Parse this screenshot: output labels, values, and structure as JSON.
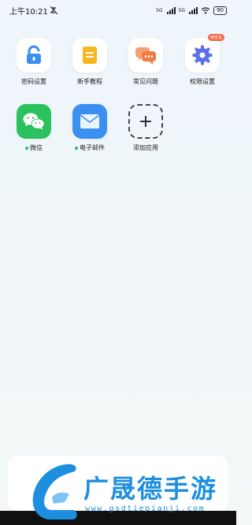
{
  "status_bar": {
    "time": "上午10:21",
    "signal1_label": "5G",
    "signal2_label": "5G",
    "battery": "90"
  },
  "apps": {
    "row1": [
      {
        "label": "密码设置",
        "icon": "unlock-icon",
        "color": "#3a90f0"
      },
      {
        "label": "新手教程",
        "icon": "document-icon",
        "color": "#f5b81c"
      },
      {
        "label": "常见问题",
        "icon": "chat-bubbles-icon",
        "color": "#f07c45"
      },
      {
        "label": "权限设置",
        "icon": "gear-icon",
        "color": "#5b6fe6",
        "badge": "待优化"
      }
    ],
    "row2": [
      {
        "label": "微信",
        "icon": "wechat-icon",
        "color": "#2bc15c"
      },
      {
        "label": "电子邮件",
        "icon": "mail-icon",
        "color": "#3b8ff0"
      },
      {
        "label": "添加应用",
        "icon": "plus-icon"
      }
    ]
  },
  "watermark": {
    "title": "广晟德手游",
    "url": "www.gsdtiepianji.com"
  }
}
